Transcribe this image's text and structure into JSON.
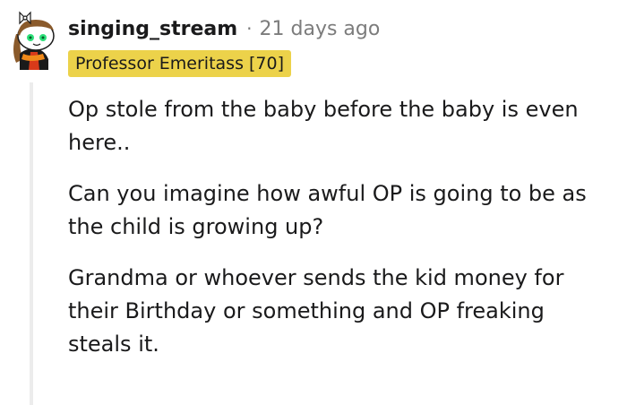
{
  "comment": {
    "username": "singing_stream",
    "separator": "·",
    "timestamp": "21 days ago",
    "flair": "Professor Emeritass [70]",
    "paragraphs": [
      "Op stole from the baby before the baby is even here..",
      "Can you imagine how awful OP is going to be as the child is growing up?",
      "Grandma or whoever sends the kid money for their Birthday or something and OP freaking steals it."
    ]
  },
  "colors": {
    "flair_background": "#ecd24a",
    "meta_text": "#7c7c7c",
    "thread_line": "#ececec",
    "avatar_eyes": "#2ee07a"
  },
  "icons": {
    "avatar": "snoo-avatar-icon"
  }
}
